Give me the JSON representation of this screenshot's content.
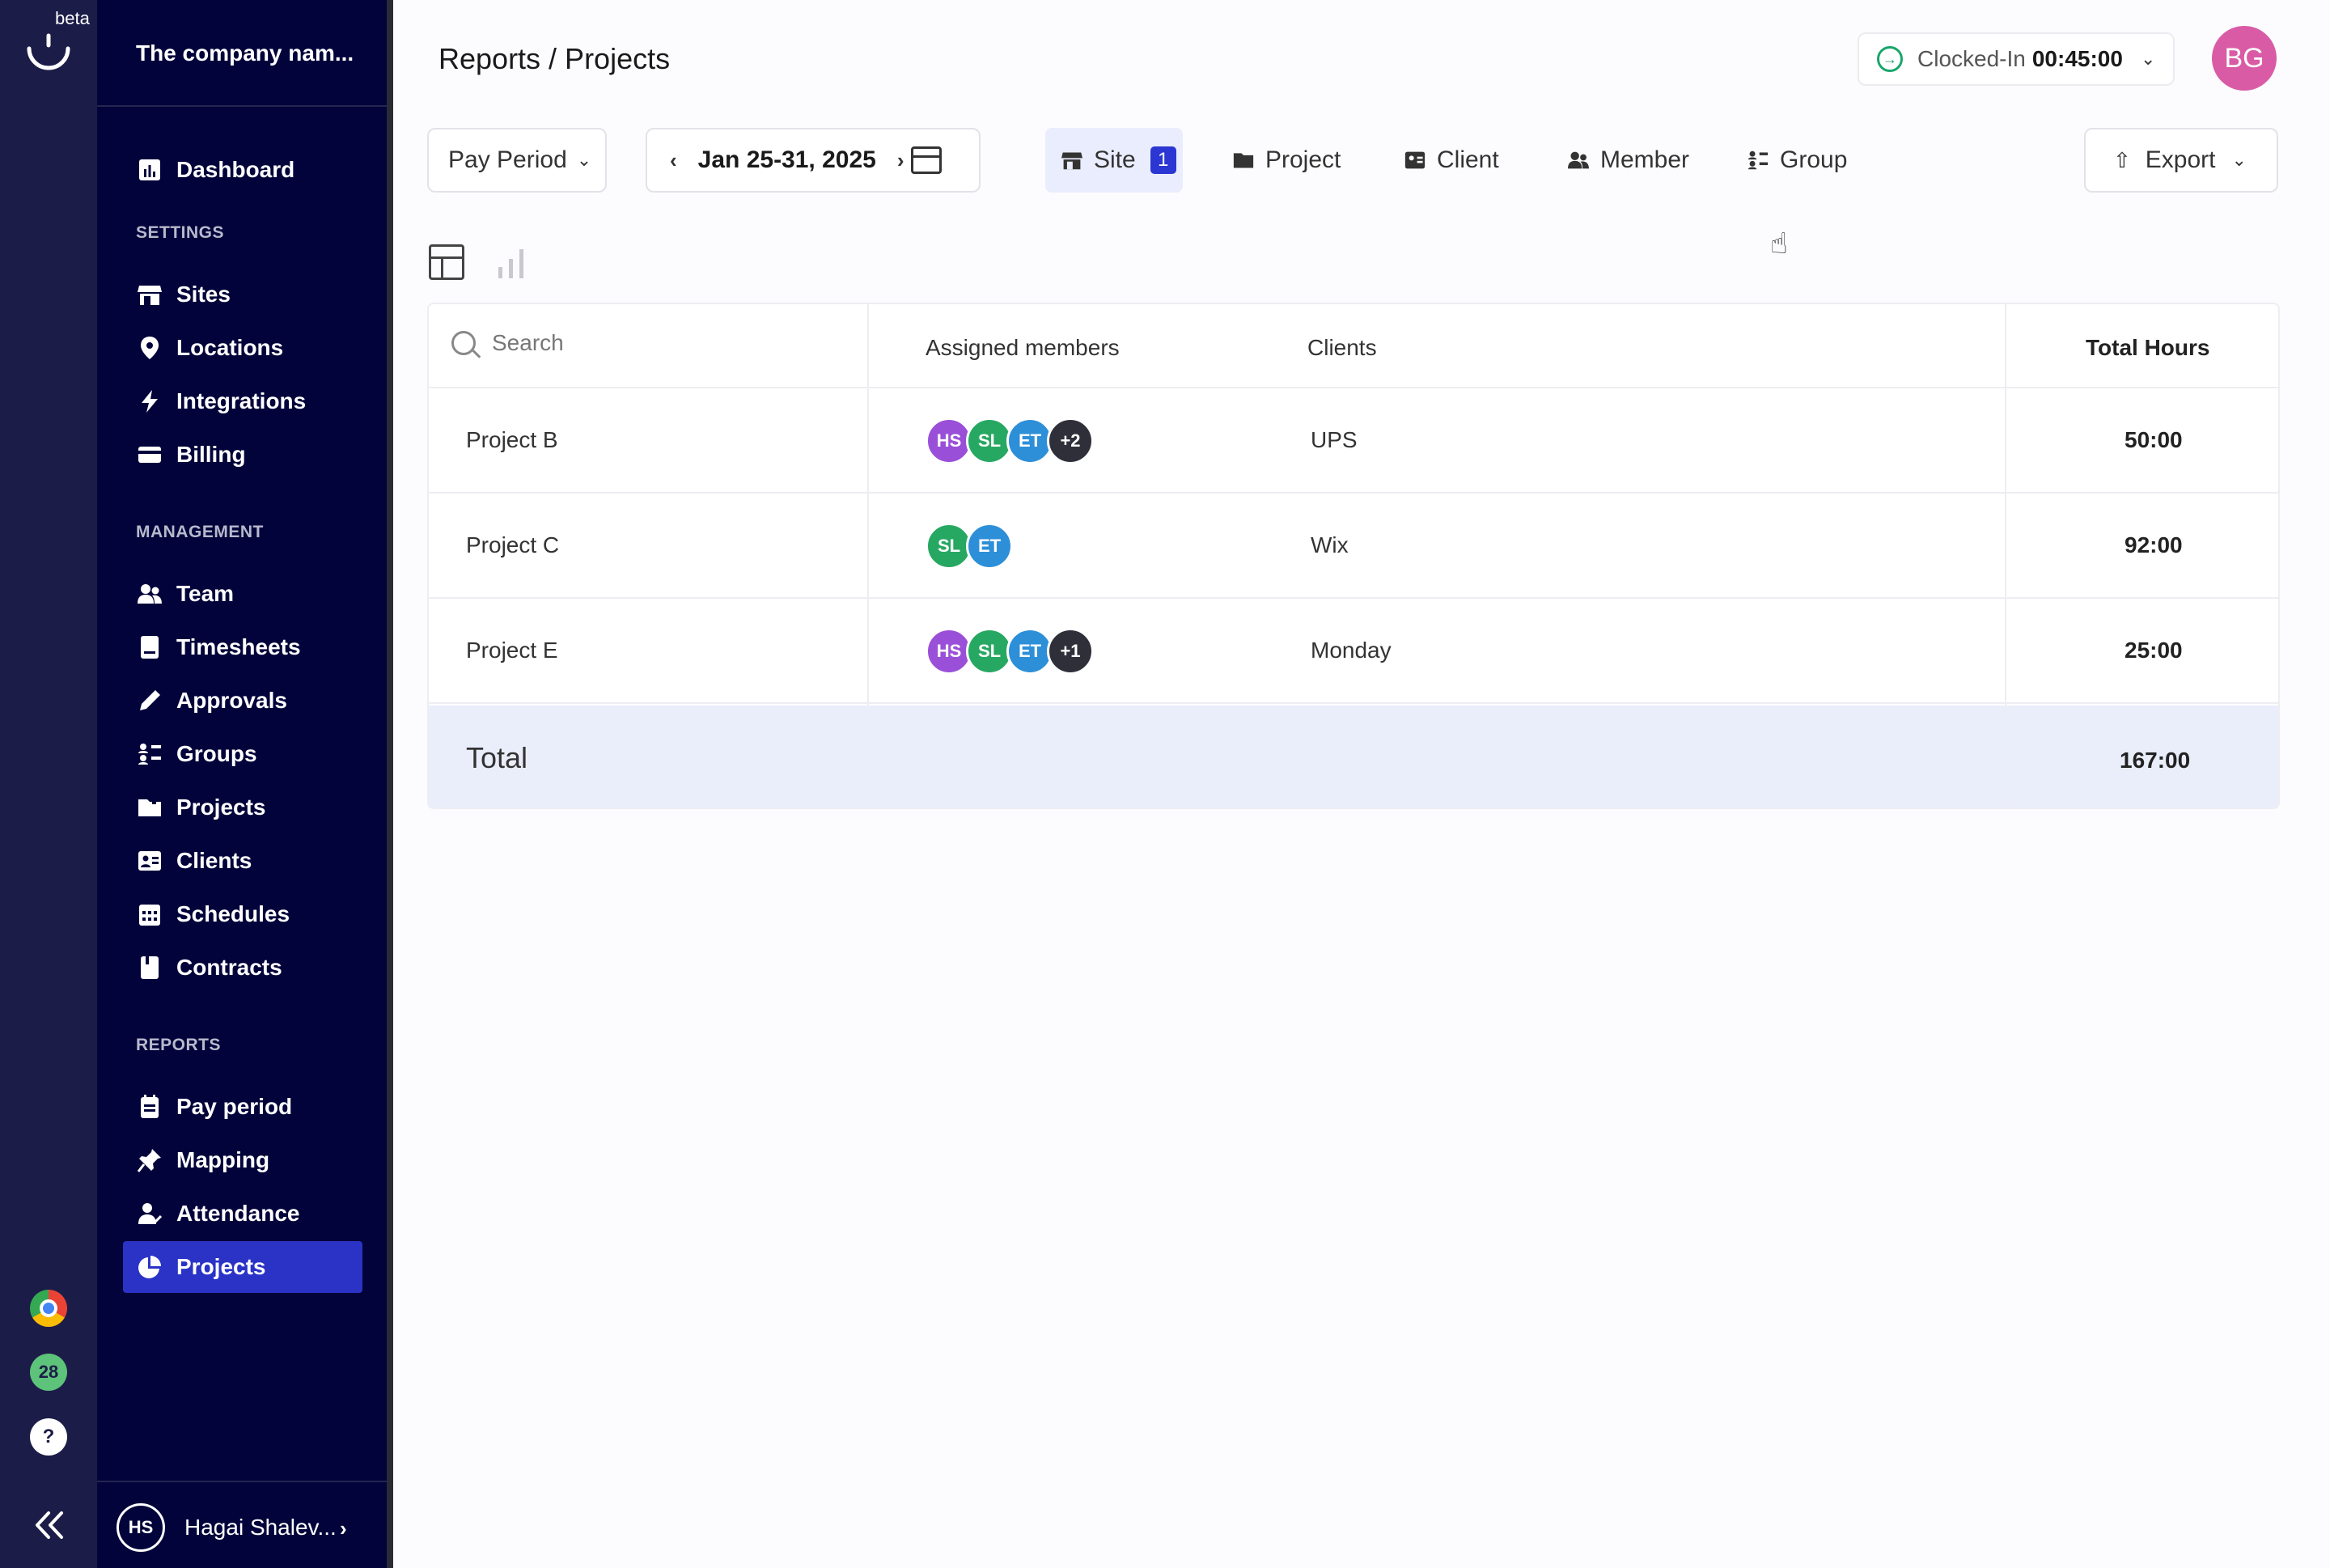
{
  "rail": {
    "beta_label": "beta",
    "badge_count": "28",
    "help_label": "?"
  },
  "sidebar": {
    "company_name": "The company nam...",
    "dashboard": "Dashboard",
    "settings_label": "SETTINGS",
    "settings_items": [
      "Sites",
      "Locations",
      "Integrations",
      "Billing"
    ],
    "management_label": "MANAGEMENT",
    "management_items": [
      "Team",
      "Timesheets",
      "Approvals",
      "Groups",
      "Projects",
      "Clients",
      "Schedules",
      "Contracts"
    ],
    "reports_label": "REPORTS",
    "reports_items": [
      "Pay period",
      "Mapping",
      "Attendance",
      "Projects"
    ],
    "user_initials": "HS",
    "user_name": "Hagai Shalev..."
  },
  "header": {
    "breadcrumb": "Reports / Projects",
    "clock_status": "Clocked-In",
    "clock_time": "00:45:00",
    "profile_initials": "BG"
  },
  "filters": {
    "pay_period": "Pay Period",
    "date_range": "Jan 25-31, 2025",
    "site": "Site",
    "site_count": "1",
    "project": "Project",
    "client": "Client",
    "member": "Member",
    "group": "Group",
    "export": "Export"
  },
  "table": {
    "search_placeholder": "Search",
    "col_members": "Assigned members",
    "col_clients": "Clients",
    "col_total": "Total Hours",
    "rows": [
      {
        "project": "Project B",
        "avatars": [
          "HS",
          "SL",
          "ET"
        ],
        "more": "+2",
        "client": "UPS",
        "hours": "50:00"
      },
      {
        "project": "Project C",
        "avatars": [
          "SL",
          "ET"
        ],
        "more": "",
        "client": "Wix",
        "hours": "92:00"
      },
      {
        "project": "Project E",
        "avatars": [
          "HS",
          "SL",
          "ET"
        ],
        "more": "+1",
        "client": "Monday",
        "hours": "25:00"
      }
    ],
    "total_label": "Total",
    "total_hours": "167:00"
  },
  "colors": {
    "sidebar_bg": "#01033a",
    "accent": "#2a33c6",
    "profile": "#d95ba6"
  }
}
